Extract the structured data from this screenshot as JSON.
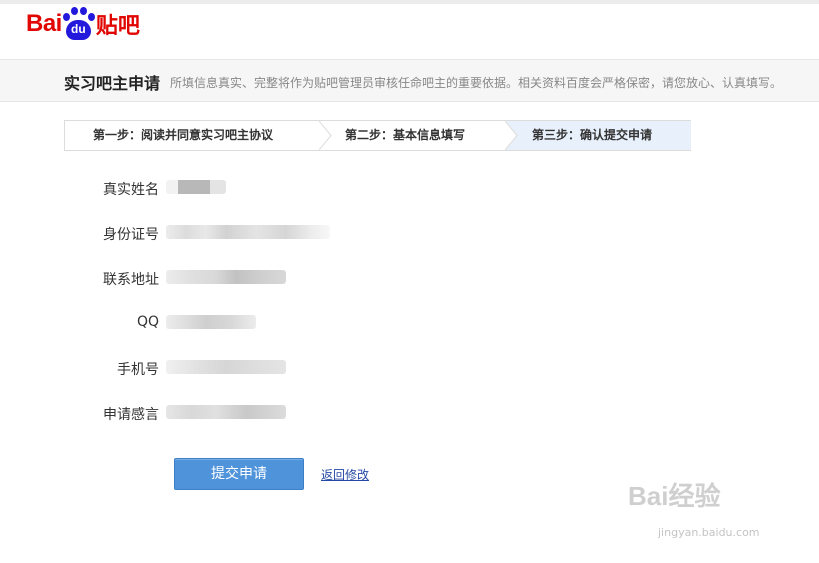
{
  "logo": {
    "bai": "Bai",
    "du": "du",
    "tieba": "贴吧"
  },
  "header": {
    "title": "实习吧主申请",
    "description": "所填信息真实、完整将作为贴吧管理员审核任命吧主的重要依据。相关资料百度会严格保密，请您放心、认真填写。"
  },
  "steps": [
    {
      "label": "第一步：阅读并同意实习吧主协议",
      "active": false
    },
    {
      "label": "第二步：基本信息填写",
      "active": false
    },
    {
      "label": "第三步：确认提交申请",
      "active": true
    }
  ],
  "form": {
    "fields": [
      {
        "label": "真实姓名"
      },
      {
        "label": "身份证号"
      },
      {
        "label": "联系地址"
      },
      {
        "label": "QQ"
      },
      {
        "label": "手机号"
      },
      {
        "label": "申请感言"
      }
    ]
  },
  "actions": {
    "submit_label": "提交申请",
    "back_label": "返回修改"
  },
  "watermark": {
    "logo": "Bai经验",
    "url": "jingyan.baidu.com"
  },
  "colors": {
    "brand_red": "#e10602",
    "brand_blue": "#2319dc",
    "button_blue": "#4f93db",
    "link_blue": "#2448a5",
    "active_step_bg": "#e8f0fb"
  }
}
